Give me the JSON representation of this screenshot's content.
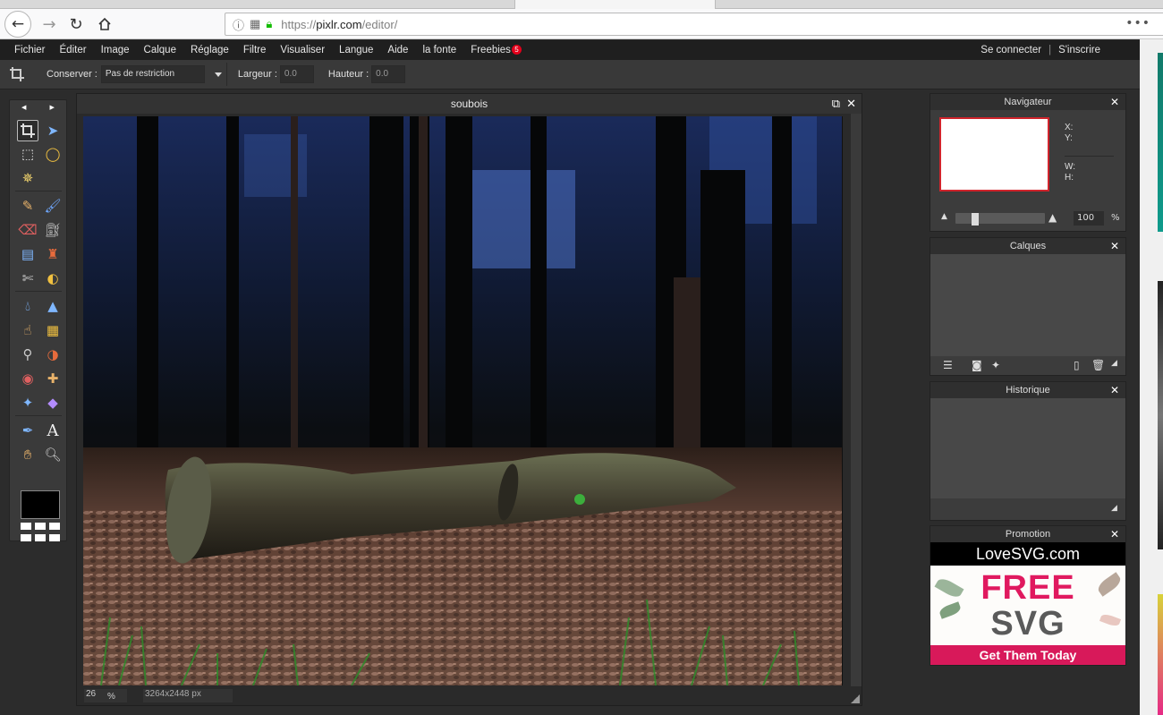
{
  "browser": {
    "url_prefix": "https://",
    "url_host": "pixlr.com",
    "url_path": "/editor/"
  },
  "menu": {
    "items": [
      "Fichier",
      "Éditer",
      "Image",
      "Calque",
      "Réglage",
      "Filtre",
      "Visualiser",
      "Langue",
      "Aide",
      "la fonte",
      "Freebies"
    ],
    "freebies_badge": "5",
    "login": "Se connecter",
    "separator": "|",
    "signup": "S'inscrire"
  },
  "options": {
    "keep_label": "Conserver :",
    "keep_value": "Pas de restriction",
    "width_label": "Largeur :",
    "width_value": "0.0",
    "height_label": "Hauteur :",
    "height_value": "0.0"
  },
  "document": {
    "title": "soubois",
    "zoom": "26",
    "zoom_unit": "%",
    "dimensions": "3264x2448 px"
  },
  "panels": {
    "navigator": {
      "title": "Navigateur",
      "x_label": "X:",
      "y_label": "Y:",
      "w_label": "W:",
      "h_label": "H:",
      "zoom_value": "100",
      "zoom_unit": "%",
      "zoom_level": 0.2
    },
    "layers": {
      "title": "Calques"
    },
    "history": {
      "title": "Historique"
    },
    "promotion": {
      "title": "Promotion",
      "ad_brand": "LoveSVG.com",
      "ad_line1": "FREE",
      "ad_line2": "SVG",
      "ad_cta": "Get Them Today"
    }
  },
  "colors": {
    "accent_red": "#d0242c",
    "badge_red": "#e3001b",
    "ad_pink": "#e0195f"
  }
}
